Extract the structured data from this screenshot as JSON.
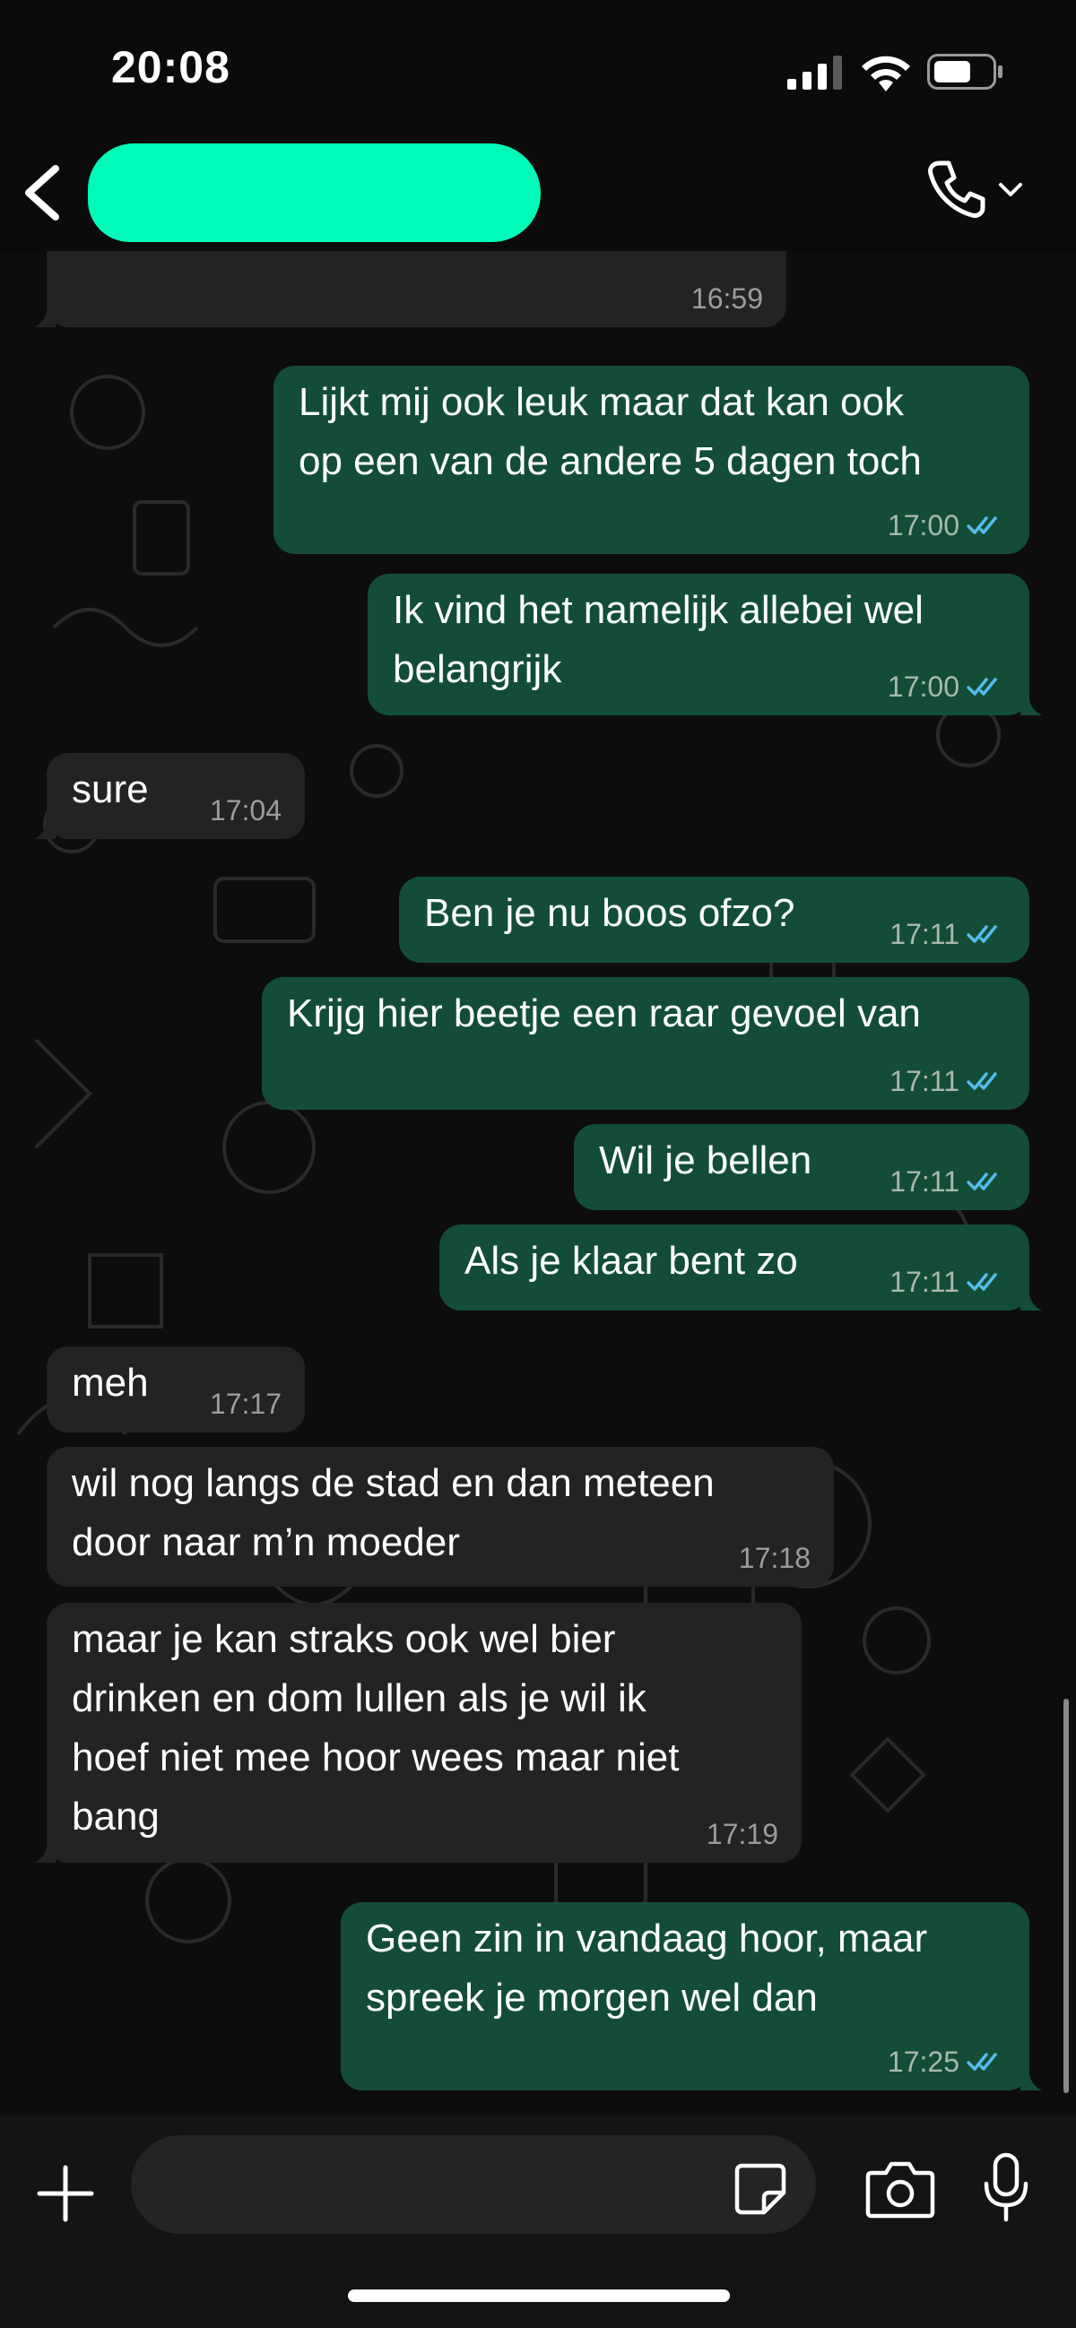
{
  "status": {
    "time": "20:08"
  },
  "header": {
    "contact_name": ""
  },
  "messages": [
    {
      "dir": "in",
      "text": "",
      "time": "16:59"
    },
    {
      "dir": "out",
      "text": "Lijkt mij ook leuk maar dat kan ook\nop een van de andere 5 dagen toch",
      "time": "17:00",
      "read": true
    },
    {
      "dir": "out",
      "text": "Ik vind het namelijk allebei wel\nbelangrijk",
      "time": "17:00",
      "read": true
    },
    {
      "dir": "in",
      "text": "sure",
      "time": "17:04"
    },
    {
      "dir": "out",
      "text": "Ben je nu boos ofzo?",
      "time": "17:11",
      "read": true
    },
    {
      "dir": "out",
      "text": "Krijg hier beetje een raar gevoel van",
      "time": "17:11",
      "read": true
    },
    {
      "dir": "out",
      "text": "Wil je bellen",
      "time": "17:11",
      "read": true
    },
    {
      "dir": "out",
      "text": "Als je klaar bent zo",
      "time": "17:11",
      "read": true
    },
    {
      "dir": "in",
      "text": "meh",
      "time": "17:17"
    },
    {
      "dir": "in",
      "text": "wil nog langs de stad en dan meteen\ndoor naar m’n moeder",
      "time": "17:18"
    },
    {
      "dir": "in",
      "text": "maar je kan straks ook wel bier\ndrinken en dom lullen als je wil ik\nhoef niet mee hoor wees maar niet\nbang",
      "time": "17:19"
    },
    {
      "dir": "out",
      "text": "Geen zin in vandaag hoor, maar\nspreek je morgen wel dan",
      "time": "17:25",
      "read": true
    }
  ],
  "input": {
    "value": "",
    "placeholder": ""
  },
  "colors": {
    "outgoing": "#144d37",
    "incoming": "#232323",
    "read_tick": "#53bdeb",
    "redaction": "#00fbb8"
  },
  "icons": [
    "back-chevron-icon",
    "phone-icon",
    "chevron-down-icon",
    "plus-icon",
    "sticker-icon",
    "camera-icon",
    "microphone-icon",
    "double-check-icon",
    "signal-icon",
    "wifi-icon",
    "battery-icon"
  ]
}
